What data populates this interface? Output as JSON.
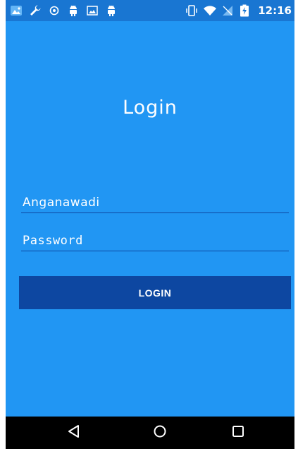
{
  "status_bar": {
    "time": "12:16",
    "left_icons": [
      "gallery-app-icon",
      "wrench-icon",
      "shield-icon",
      "android-icon",
      "image-icon",
      "android-icon"
    ],
    "right_icons": [
      "vibrate-icon",
      "wifi-icon",
      "no-signal-icon",
      "battery-charging-icon"
    ]
  },
  "login": {
    "title": "Login",
    "username_placeholder": "Anganawadi",
    "password_placeholder": "Password",
    "button_label": "LOGIN"
  },
  "nav_bar": {
    "buttons": [
      "back-icon",
      "home-icon",
      "recents-icon"
    ]
  },
  "colors": {
    "background": "#2196F3",
    "status_bar": "#1976D2",
    "button": "#0D47A1",
    "underline": "#0D47A1",
    "nav_bar": "#000000",
    "text": "#FFFFFF"
  }
}
